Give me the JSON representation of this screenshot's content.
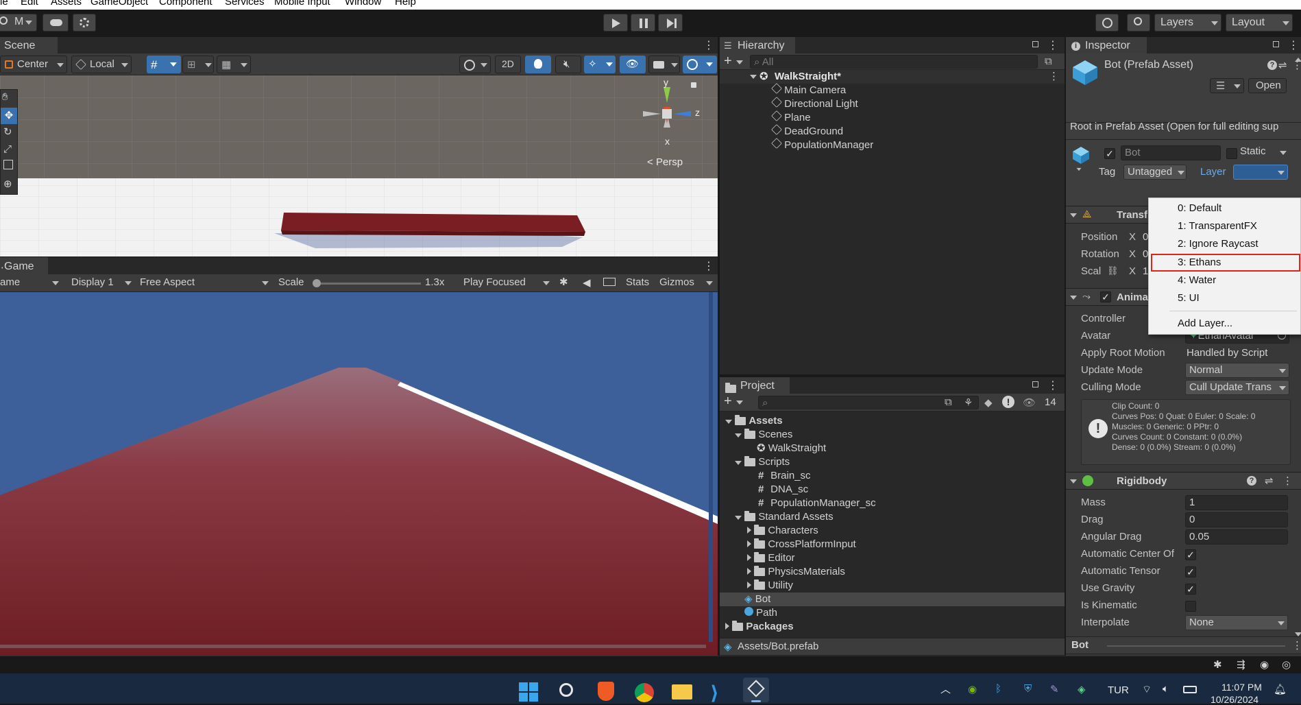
{
  "menu": [
    "le",
    "Edit",
    "Assets",
    "GameObject",
    "Component",
    "Services",
    "Mobile Input",
    "Window",
    "Help"
  ],
  "toolbar": {
    "account_label": "M",
    "play_icon": "play-icon",
    "layers_label": "Layers",
    "layout_label": "Layout"
  },
  "scene": {
    "tab": "Scene",
    "pivot": "Center",
    "space": "Local",
    "mode_2d": "2D",
    "gizmo_axes": {
      "y": "y",
      "z": "z",
      "x": "x"
    },
    "persp": "Persp"
  },
  "game": {
    "tab": "Game",
    "game_dropdown": "ame",
    "display": "Display 1",
    "aspect": "Free Aspect",
    "scale_label": "Scale",
    "scale_value": "1.3x",
    "play_mode": "Play Focused",
    "stats": "Stats",
    "gizmos": "Gizmos",
    "scale_fraction": 0.0
  },
  "hierarchy": {
    "tab": "Hierarchy",
    "search_placeholder": "All",
    "scene_name": "WalkStraight*",
    "items": [
      "Main Camera",
      "Directional Light",
      "Plane",
      "DeadGround",
      "PopulationManager"
    ]
  },
  "project": {
    "tab": "Project",
    "hidden_count": "14",
    "tree": {
      "assets": "Assets",
      "scenes": "Scenes",
      "walkstraight": "WalkStraight",
      "scripts": "Scripts",
      "brain": "Brain_sc",
      "dna": "DNA_sc",
      "popmgr": "PopulationManager_sc",
      "standard": "Standard Assets",
      "characters": "Characters",
      "cpi": "CrossPlatformInput",
      "editor": "Editor",
      "physmat": "PhysicsMaterials",
      "utility": "Utility",
      "bot": "Bot",
      "path": "Path",
      "packages": "Packages"
    },
    "footer_path": "Assets/Bot.prefab"
  },
  "inspector": {
    "tab": "Inspector",
    "title": "Bot (Prefab Asset)",
    "open": "Open",
    "root_note": "Root in Prefab Asset (Open for full editing sup",
    "name_value": "Bot",
    "static": "Static",
    "tag_label": "Tag",
    "tag_value": "Untagged",
    "layer_label": "Layer",
    "transform": {
      "title": "Transf",
      "position": "Position",
      "rotation": "Rotation",
      "scale": "Scal",
      "x": "X",
      "pos_x": "0",
      "rot_x": "0",
      "scale_x": "1"
    },
    "animator": {
      "title": "Anima",
      "controller": "Controller",
      "avatar": "Avatar",
      "avatar_value": "EthanAvatar",
      "apply_root": "Apply Root Motion",
      "apply_root_value": "Handled by Script",
      "update_mode": "Update Mode",
      "update_mode_value": "Normal",
      "culling_mode": "Culling Mode",
      "culling_mode_value": "Cull Update Trans",
      "info": [
        "Clip Count: 0",
        "Curves Pos: 0 Quat: 0 Euler: 0 Scale: 0",
        "Muscles: 0 Generic: 0 PPtr: 0",
        "Curves Count: 0 Constant: 0 (0.0%)",
        "Dense: 0 (0.0%) Stream: 0 (0.0%)"
      ]
    },
    "rigidbody": {
      "title": "Rigidbody",
      "mass": "Mass",
      "mass_value": "1",
      "drag": "Drag",
      "drag_value": "0",
      "angular_drag": "Angular Drag",
      "angular_drag_value": "0.05",
      "auto_center": "Automatic Center Of",
      "auto_tensor": "Automatic Tensor",
      "use_gravity": "Use Gravity",
      "is_kinematic": "Is Kinematic",
      "interpolate": "Interpolate",
      "interpolate_value": "None"
    },
    "footer": "Bot"
  },
  "layer_menu": {
    "items": [
      "0: Default",
      "1: TransparentFX",
      "2: Ignore Raycast",
      "3: Ethans",
      "4: Water",
      "5: UI"
    ],
    "add": "Add Layer...",
    "highlighted": "3: Ethans"
  },
  "taskbar": {
    "language": "TUR",
    "time": "11:07 PM",
    "date": "10/26/2024"
  },
  "colors": {
    "accent_blue": "#3a72b0",
    "highlight_red": "#e2231a",
    "sky_blue": "#3d5f9a",
    "ground_red": "#7a2a30"
  }
}
